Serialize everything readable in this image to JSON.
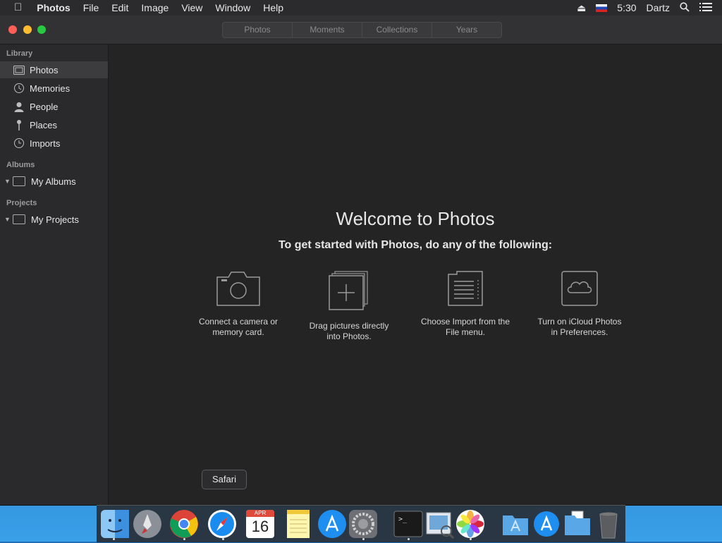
{
  "menubar": {
    "apple": "",
    "app_name": "Photos",
    "menus": [
      "File",
      "Edit",
      "Image",
      "View",
      "Window",
      "Help"
    ],
    "time": "5:30",
    "user": "Dartz"
  },
  "toolbar": {
    "segments": [
      "Photos",
      "Moments",
      "Collections",
      "Years"
    ]
  },
  "sidebar": {
    "library_header": "Library",
    "library_items": [
      "Photos",
      "Memories",
      "People",
      "Places",
      "Imports"
    ],
    "albums_header": "Albums",
    "albums_item": "My Albums",
    "projects_header": "Projects",
    "projects_item": "My Projects"
  },
  "main": {
    "title": "Welcome to Photos",
    "subtitle": "To get started with Photos, do any of the following:",
    "options": [
      {
        "line1": "Connect a camera or",
        "line2": "memory card."
      },
      {
        "line1": "Drag pictures directly",
        "line2": "into Photos."
      },
      {
        "line1": "Choose Import from the",
        "line2": "File menu."
      },
      {
        "line1": "Turn on iCloud Photos",
        "line2": "in Preferences."
      }
    ]
  },
  "dock": {
    "tooltip": "Safari",
    "calendar_month": "APR",
    "calendar_day": "16"
  },
  "colors": {
    "window_bg": "#242424",
    "sidebar_bg": "#2a2a2c",
    "selected_row": "#3c3c3e",
    "close": "#ff5f57",
    "minimize": "#febc2e",
    "zoom": "#28c840"
  }
}
